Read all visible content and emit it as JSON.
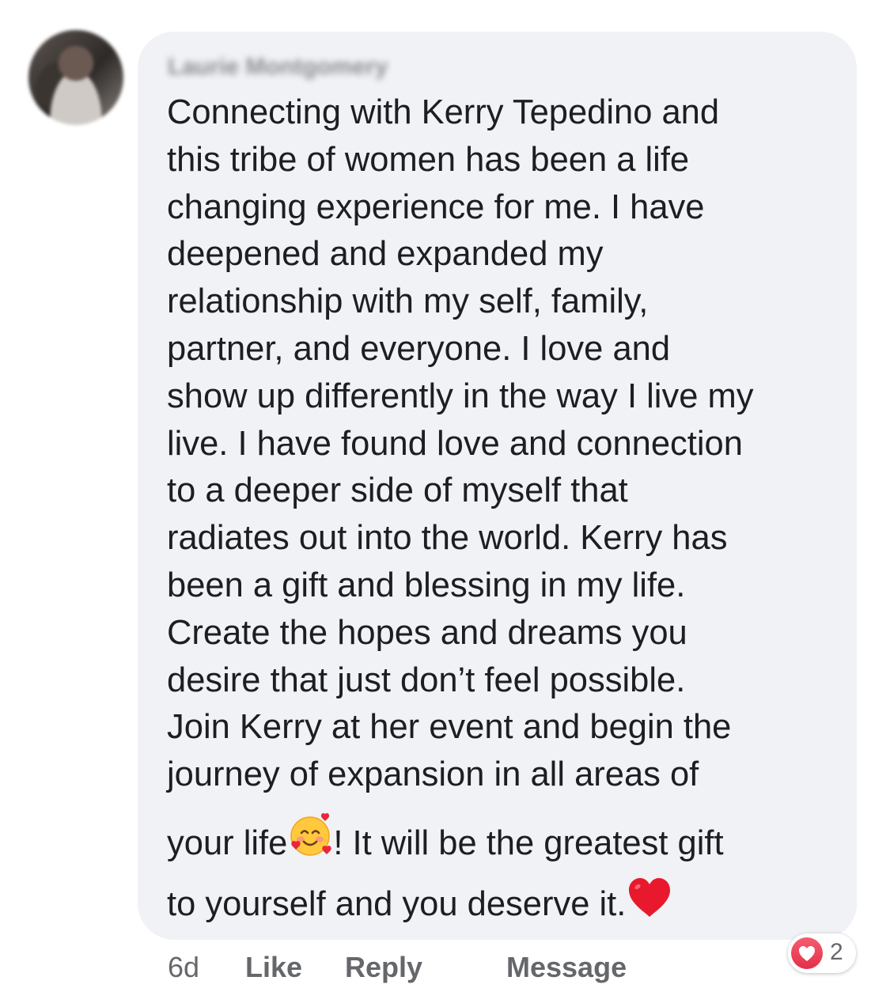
{
  "comment": {
    "author_name": "Laurie Montgomery",
    "text_lines": [
      "Connecting with Kerry Tepedino and",
      "this tribe of women has been a life",
      "changing experience for me.  I have",
      "deepened and expanded my",
      "relationship with my self, family,",
      "partner, and everyone.  I love and",
      "show up differently in the way I live my",
      "live.  I have found love and connection",
      "to a deeper side of myself that",
      "radiates out into the world.  Kerry has",
      "been a gift and blessing in my life.",
      "Create the hopes and dreams you",
      "desire that just don’t feel possible.",
      "Join Kerry at her event and begin the",
      "journey of expansion in all areas of"
    ],
    "line_16_before": "your life",
    "line_16_after": "!  It will be the greatest gift",
    "line_17": "to yourself and you deserve it.",
    "emojis": [
      "smiling-face-with-hearts-icon",
      "red-heart-icon"
    ]
  },
  "actions": {
    "time": "6d",
    "like": "Like",
    "reply": "Reply",
    "message": "Message"
  },
  "reactions": {
    "icon": "love-reaction-icon",
    "count": "2",
    "color": "#f33e58"
  },
  "colors": {
    "bubble_bg": "#f0f2f5",
    "text": "#1c1e21",
    "secondary": "#65676b"
  }
}
